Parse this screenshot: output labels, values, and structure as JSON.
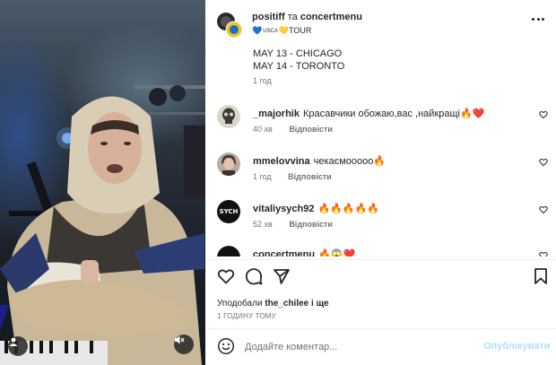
{
  "post": {
    "header": {
      "author": "positiff",
      "connector": "та",
      "coauthor": "concertmenu",
      "subtitle_prefix": "💙",
      "subtitle_small": "USCA",
      "subtitle_suffix": "💛TOUR"
    },
    "caption": {
      "lines": [
        "MAY 13 - CHICAGO",
        "MAY 14 - TORONTO"
      ],
      "time": "1 год"
    },
    "comments": [
      {
        "username": "_majorhik",
        "text": "Красавчики обожаю,вас ,найкращі🔥❤️",
        "time": "40 хв",
        "reply_label": "Відповісти",
        "avatar": "skull-avatar"
      },
      {
        "username": "mmelovvina",
        "text": "чекаємооооо🔥",
        "time": "1 год",
        "reply_label": "Відповісти",
        "avatar": "portrait-avatar"
      },
      {
        "username": "vitaliysych92",
        "text": "🔥🔥🔥🔥🔥",
        "time": "52 хв",
        "reply_label": "Відповісти",
        "avatar": "sych-avatar",
        "avatar_text": "SYCH"
      },
      {
        "username": "concertmenu",
        "text": "🔥😱❤️",
        "time": "",
        "reply_label": "",
        "avatar": "concert-avatar"
      }
    ],
    "likes": {
      "prefix": "Уподобали",
      "user": "the_chilee",
      "suffix": "і ще"
    },
    "date": "1 ГОДИНУ ТОМУ",
    "add_comment": {
      "placeholder": "Додайте коментар...",
      "post_label": "Опублікувати"
    }
  },
  "colors": {
    "text": "#262626",
    "secondary": "#737373",
    "link_disabled": "#b2dffc",
    "divider": "#efefef"
  }
}
